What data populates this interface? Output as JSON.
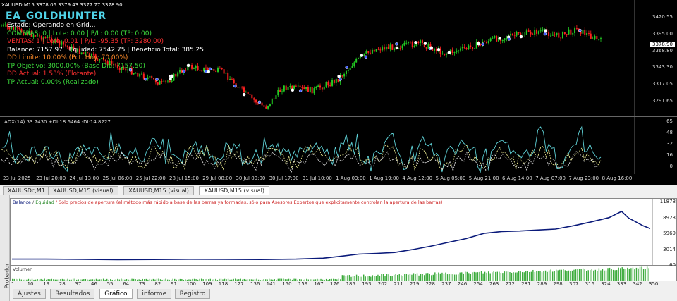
{
  "chart": {
    "symbol_title": "XAUUSD,M15  3378.06 3379.43 3377.77 3378.90",
    "ea_name": "EA_GOLDHUNTER",
    "info_lines": [
      {
        "text": "Estado: Operando en Grid...",
        "color": "#ffffff"
      },
      {
        "text": "COMPRAS: 0 | Lote: 0.00 | P/L: 0.00 (TP: 0.00)",
        "color": "#3ddc3d"
      },
      {
        "text": "VENTAS: 1 | Lote: 0.01 | P/L: -95.35 (TP: 3280.00)",
        "color": "#ff3030"
      },
      {
        "text": "Balance: 7157.97 | Equidad: 7542.75 | Beneficio Total: 385.25",
        "color": "#ffffff"
      },
      {
        "text": "DD Limite: 10.00% (Pct. Hoy: 70.00%)",
        "color": "#ff8c2a"
      },
      {
        "text": "TP Objetivo: 3000.00% (Base Dia: 7157.50)",
        "color": "#3ddc3d"
      },
      {
        "text": "DD Actual: 1.53% (Flotante)",
        "color": "#ff3030"
      },
      {
        "text": "TP Actual: 0.00% (Realizado)",
        "color": "#3ddc3d"
      }
    ],
    "current_price": "3378.90",
    "price_axis": [
      "3420.55",
      "3395.00",
      "3368.80",
      "3343.30",
      "3317.05",
      "3291.65",
      "3266.05"
    ],
    "adx_title": "ADX(14) 33.7430 +DI:18.6464 -DI:14.8227",
    "adx_axis": [
      "65",
      "48",
      "32",
      "16",
      "0"
    ],
    "date_axis": [
      "23 Jul 2025",
      "23 Jul 20:00",
      "24 Jul 13:00",
      "25 Jul 06:00",
      "25 Jul 22:00",
      "28 Jul 15:00",
      "29 Jul 08:00",
      "30 Jul 00:00",
      "30 Jul 17:00",
      "31 Jul 10:00",
      "1 Aug 03:00",
      "1 Aug 19:00",
      "4 Aug 12:00",
      "5 Aug 05:00",
      "5 Aug 21:00",
      "6 Aug 14:00",
      "7 Aug 07:00",
      "7 Aug 23:00",
      "8 Aug 16:00"
    ],
    "colors": {
      "bull": "#22cc22",
      "bear": "#ff2020",
      "adx": "#5fd3d8",
      "plus_di": "#e8e890",
      "minus_di": "#d8d8d8"
    }
  },
  "chart_tabs": [
    {
      "label": "XAUUSDc,M1",
      "active": false
    },
    {
      "label": "XAUUSD,M15 (visual)",
      "active": false
    },
    {
      "label": "XAUUSD,M15 (visual)",
      "active": false
    },
    {
      "label": "XAUUSD,M15 (visual)",
      "active": true
    }
  ],
  "tester": {
    "side_label": "Probador",
    "legend_balance": "Balance",
    "legend_sep": "/",
    "legend_equity": "Equidad",
    "legend_note": "/ Sólo precios de apertura (el método más rápido a base de las barras ya formadas, sólo para Asesores Expertos que explícitamente controlan la apertura de las barras)",
    "volume_label": "Volumen",
    "balance_axis": [
      "11878",
      "8923",
      "5969",
      "3014",
      "60"
    ],
    "trade_axis": [
      "1",
      "10",
      "19",
      "28",
      "37",
      "46",
      "55",
      "64",
      "73",
      "82",
      "91",
      "100",
      "109",
      "118",
      "127",
      "136",
      "141",
      "150",
      "159",
      "167",
      "176",
      "185",
      "193",
      "202",
      "211",
      "219",
      "228",
      "237",
      "246",
      "254",
      "263",
      "272",
      "281",
      "289",
      "298",
      "307",
      "316",
      "324",
      "333",
      "342",
      "350"
    ],
    "colors": {
      "balance": "#0a1a7a",
      "equity": "#2a8a2a",
      "note": "#cc2222",
      "volume": "#3aaa3a"
    }
  },
  "bottom_tabs": [
    {
      "label": "Ajustes",
      "active": false
    },
    {
      "label": "Resultados",
      "active": false
    },
    {
      "label": "Gráfico",
      "active": true
    },
    {
      "label": "informe",
      "active": false
    },
    {
      "label": "Registro",
      "active": false
    }
  ],
  "balance_curve": {
    "type": "line",
    "x_range": [
      1,
      358
    ],
    "y_range": [
      60,
      11878
    ],
    "points": [
      [
        1,
        1000
      ],
      [
        20,
        1000
      ],
      [
        40,
        940
      ],
      [
        60,
        880
      ],
      [
        80,
        920
      ],
      [
        100,
        980
      ],
      [
        120,
        960
      ],
      [
        140,
        920
      ],
      [
        160,
        1000
      ],
      [
        175,
        1200
      ],
      [
        185,
        1600
      ],
      [
        195,
        2050
      ],
      [
        205,
        2200
      ],
      [
        215,
        2400
      ],
      [
        225,
        3000
      ],
      [
        235,
        3700
      ],
      [
        245,
        4500
      ],
      [
        255,
        5300
      ],
      [
        265,
        6400
      ],
      [
        275,
        6800
      ],
      [
        285,
        6900
      ],
      [
        295,
        7100
      ],
      [
        305,
        7300
      ],
      [
        315,
        8000
      ],
      [
        325,
        8800
      ],
      [
        335,
        9700
      ],
      [
        342,
        11000
      ],
      [
        346,
        9600
      ],
      [
        350,
        8800
      ],
      [
        354,
        8000
      ],
      [
        358,
        7400
      ]
    ]
  }
}
